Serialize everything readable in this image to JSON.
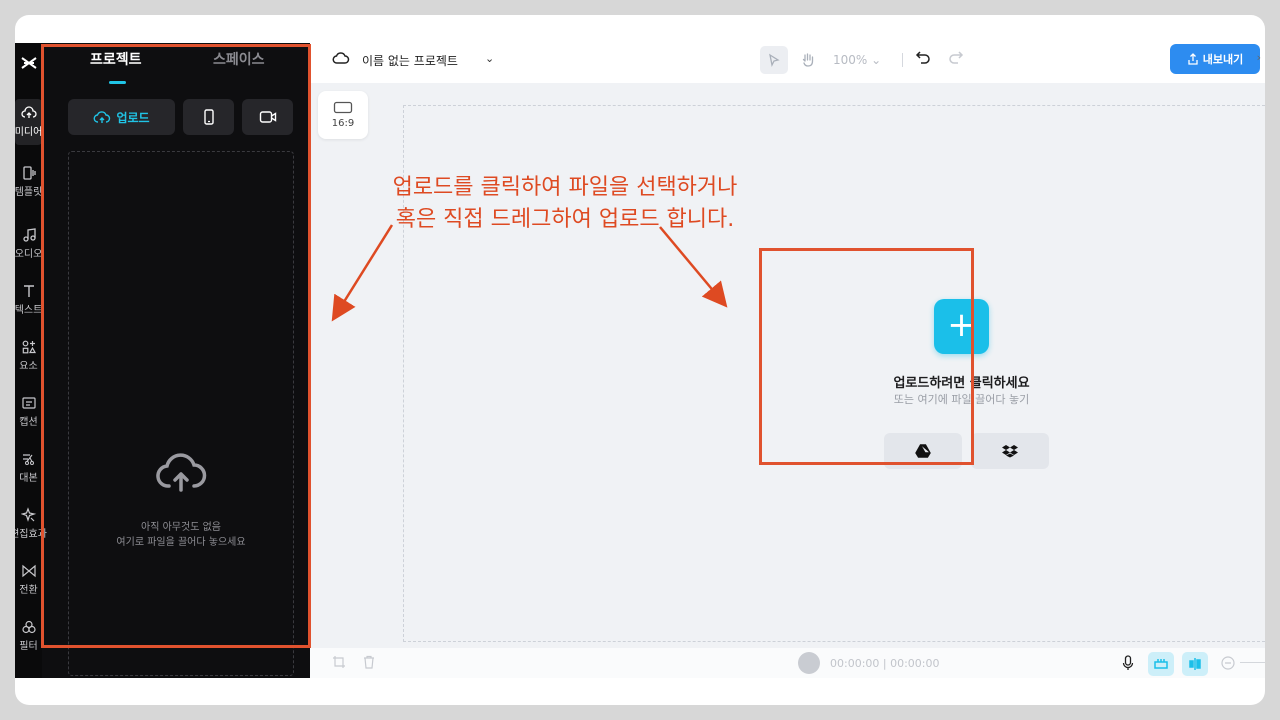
{
  "sidebar": {
    "items": [
      {
        "label": "미디어",
        "icon": "cloud-upload-icon"
      },
      {
        "label": "템플릿",
        "icon": "template-icon"
      },
      {
        "label": "오디오",
        "icon": "music-note-icon"
      },
      {
        "label": "텍스트",
        "icon": "text-icon"
      },
      {
        "label": "요소",
        "icon": "elements-icon"
      },
      {
        "label": "캡션",
        "icon": "caption-icon"
      },
      {
        "label": "대본",
        "icon": "script-icon"
      },
      {
        "label": "편집효과",
        "icon": "sparkle-icon"
      },
      {
        "label": "전환",
        "icon": "transition-icon"
      },
      {
        "label": "필터",
        "icon": "filter-icon"
      }
    ]
  },
  "panel": {
    "tabs": [
      "프로젝트",
      "스페이스"
    ],
    "upload_label": "업로드",
    "empty_line1": "아직 아무것도 없음",
    "empty_line2": "여기로 파일을 끌어다 놓으세요"
  },
  "topbar": {
    "project_title": "이름 없는 프로젝트",
    "zoom": "100%",
    "export_label": "내보내기"
  },
  "canvas": {
    "aspect_ratio": "16:9",
    "upload_title": "업로드하려면 클릭하세요",
    "upload_subtitle": "또는 여기에 파일 끌어다 놓기"
  },
  "bottombar": {
    "timecode": "00:00:00 | 00:00:00"
  },
  "annotation": {
    "line1": "업로드를 클릭하여 파일을 선택하거나",
    "line2": "혹은 직접 드레그하여 업로드 합니다.",
    "color": "#de4a22"
  },
  "colors": {
    "accent": "#1bbfe9",
    "export": "#2d8cf0",
    "dark_panel": "#0e0e10"
  }
}
